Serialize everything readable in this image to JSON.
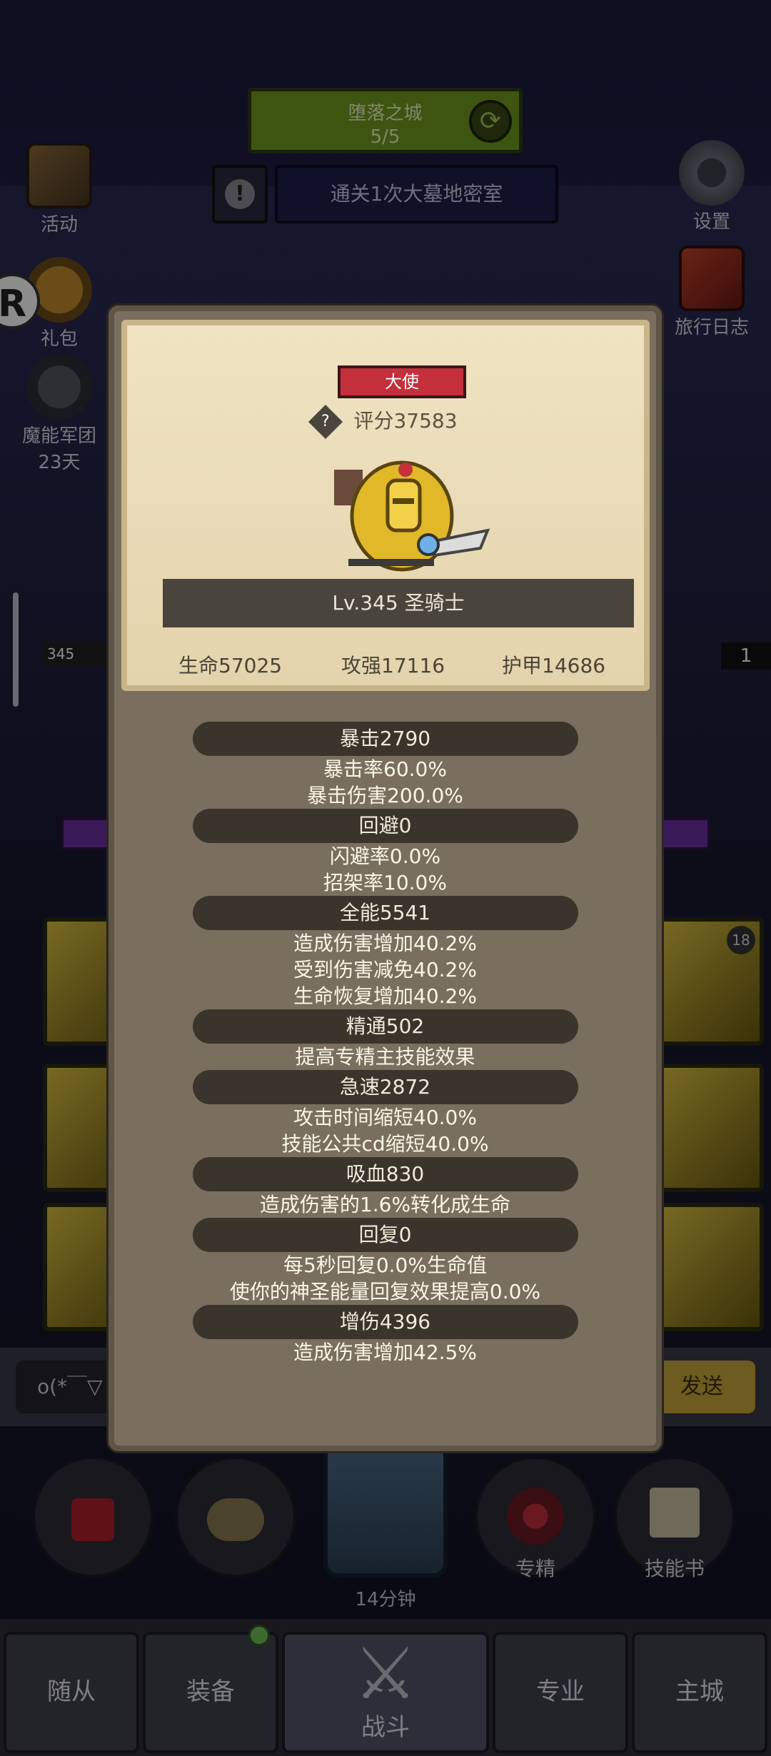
{
  "stage": {
    "name": "堕落之城",
    "progress": "5/5"
  },
  "quest": {
    "text": "通关1次大墓地密室"
  },
  "side_left": [
    {
      "label": "活动",
      "icon": "event-book-icon"
    },
    {
      "label": "礼包",
      "icon": "gift-icon"
    },
    {
      "label": "魔能军团",
      "sub": "23天",
      "icon": "legion-icon"
    }
  ],
  "side_right": [
    {
      "label": "设置",
      "icon": "gear-icon"
    },
    {
      "label": "旅行日志",
      "icon": "journal-icon"
    }
  ],
  "r_bubble": "R",
  "hp_left": "345",
  "hp_right": "1",
  "equip_badge": "18",
  "chat": {
    "input": "o(*￣▽",
    "send": "发送"
  },
  "actions": [
    {
      "label": "",
      "icon": "potion-icon"
    },
    {
      "label": "",
      "icon": "bread-icon"
    },
    {
      "label": "专精",
      "icon": "mastery-icon"
    },
    {
      "label": "技能书",
      "icon": "skill-book-icon"
    }
  ],
  "chest_timer": "14分钟",
  "nav": [
    "随从",
    "装备",
    "战斗",
    "专业",
    "主城"
  ],
  "hero_card": {
    "rank": "大使",
    "score": "评分37583",
    "name": "Lv.345 圣骑士",
    "hp": "生命57025",
    "atk": "攻强17116",
    "armor": "护甲14686"
  },
  "attributes": [
    {
      "head": "暴击2790",
      "lines": [
        "暴击率60.0%",
        "暴击伤害200.0%"
      ]
    },
    {
      "head": "回避0",
      "lines": [
        "闪避率0.0%",
        "招架率10.0%"
      ]
    },
    {
      "head": "全能5541",
      "lines": [
        "造成伤害增加40.2%",
        "受到伤害减免40.2%",
        "生命恢复增加40.2%"
      ]
    },
    {
      "head": "精通502",
      "lines": [
        "提高专精主技能效果"
      ]
    },
    {
      "head": "急速2872",
      "lines": [
        "攻击时间缩短40.0%",
        "技能公共cd缩短40.0%"
      ]
    },
    {
      "head": "吸血830",
      "lines": [
        "造成伤害的1.6%转化成生命"
      ]
    },
    {
      "head": "回复0",
      "lines": [
        "每5秒回复0.0%生命值",
        "使你的神圣能量回复效果提高0.0%"
      ]
    },
    {
      "head": "增伤4396",
      "lines": [
        "造成伤害增加42.5%"
      ]
    }
  ]
}
